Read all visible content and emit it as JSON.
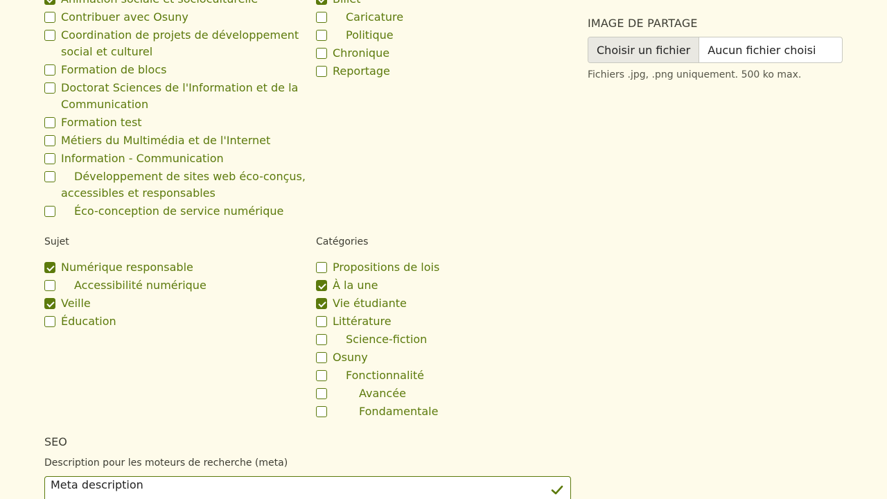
{
  "formations": [
    {
      "label": "Animation sociale et socioculturelle",
      "checked": true,
      "level": 0
    },
    {
      "label": "Contribuer avec Osuny",
      "checked": false,
      "level": 0
    },
    {
      "label": "Coordination de projets de développement social et culturel",
      "checked": false,
      "level": 0
    },
    {
      "label": "Formation de blocs",
      "checked": false,
      "level": 0
    },
    {
      "label": "Doctorat Sciences de l'Information et de la Communication",
      "checked": false,
      "level": 0
    },
    {
      "label": "Formation test",
      "checked": false,
      "level": 0
    },
    {
      "label": "Métiers du Multimédia et de l'Internet",
      "checked": false,
      "level": 0
    },
    {
      "label": "Information - Communication",
      "checked": false,
      "level": 0
    },
    {
      "label": "Développement de sites web éco-conçus, accessibles et responsables",
      "checked": false,
      "level": 1
    },
    {
      "label": "Éco-conception de service numérique",
      "checked": false,
      "level": 1
    }
  ],
  "types": [
    {
      "label": "Billet",
      "checked": true,
      "level": 0
    },
    {
      "label": "Caricature",
      "checked": false,
      "level": 1
    },
    {
      "label": "Politique",
      "checked": false,
      "level": 1
    },
    {
      "label": "Chronique",
      "checked": false,
      "level": 0
    },
    {
      "label": "Reportage",
      "checked": false,
      "level": 0
    }
  ],
  "sujet": {
    "label": "Sujet",
    "items": [
      {
        "label": "Numérique responsable",
        "checked": true,
        "level": 0
      },
      {
        "label": "Accessibilité numérique",
        "checked": false,
        "level": 1
      },
      {
        "label": "Veille",
        "checked": true,
        "level": 0
      },
      {
        "label": "Éducation",
        "checked": false,
        "level": 0
      }
    ]
  },
  "categories": {
    "label": "Catégories",
    "items": [
      {
        "label": "Propositions de lois",
        "checked": false,
        "level": 0
      },
      {
        "label": "À la une",
        "checked": true,
        "level": 0
      },
      {
        "label": "Vie étudiante",
        "checked": true,
        "level": 0
      },
      {
        "label": "Littérature",
        "checked": false,
        "level": 0
      },
      {
        "label": "Science-fiction",
        "checked": false,
        "level": 1
      },
      {
        "label": "Osuny",
        "checked": false,
        "level": 0
      },
      {
        "label": "Fonctionnalité",
        "checked": false,
        "level": 1
      },
      {
        "label": "Avancée",
        "checked": false,
        "level": 2
      },
      {
        "label": "Fondamentale",
        "checked": false,
        "level": 2
      }
    ]
  },
  "share_image": {
    "title": "IMAGE DE PARTAGE",
    "button_label": "Choisir un fichier",
    "status": "Aucun fichier choisi",
    "hint": "Fichiers .jpg, .png uniquement. 500 ko max."
  },
  "seo": {
    "title": "SEO",
    "meta_label": "Description pour les moteurs de recherche (meta)",
    "meta_value": "Meta description"
  },
  "colors": {
    "accent": "#5c7a0c",
    "background": "#fefbea"
  },
  "icons": {
    "checkbox_checked": "check-mark",
    "valid": "checkmark-icon"
  }
}
